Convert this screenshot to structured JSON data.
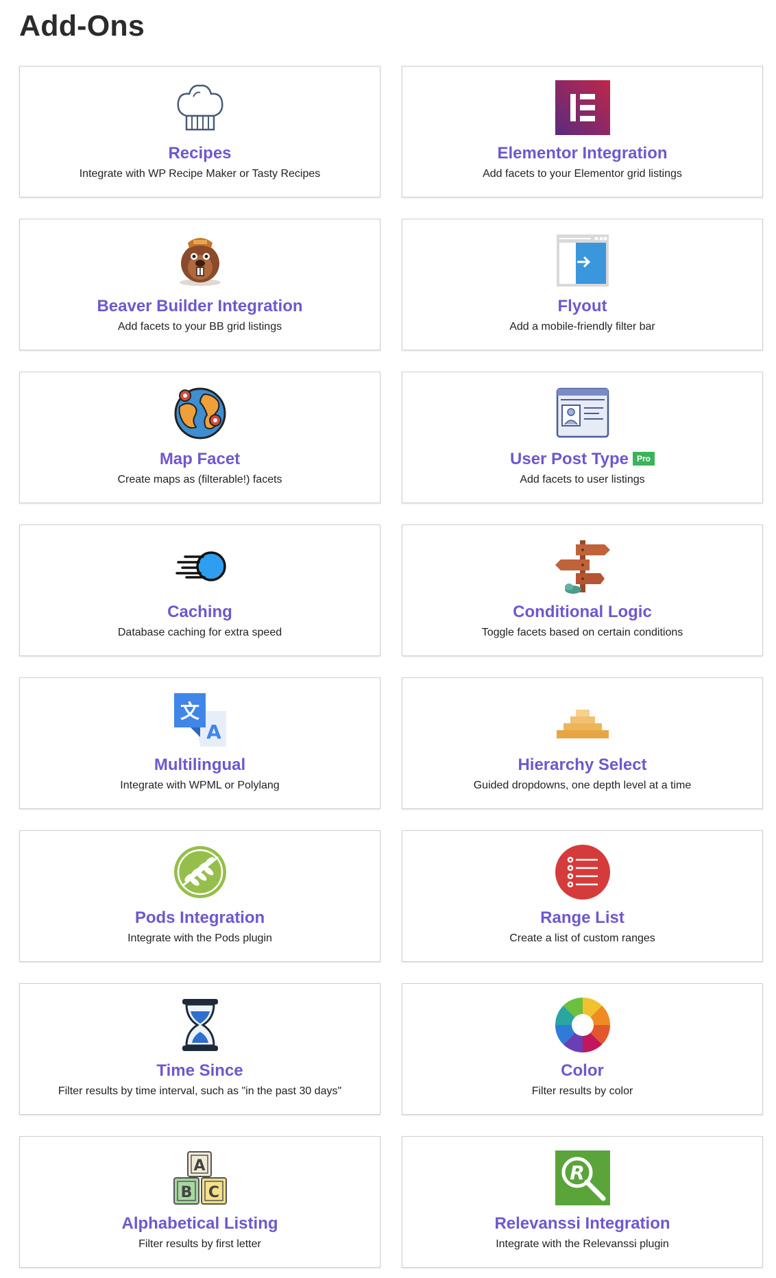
{
  "page": {
    "title": "Add-Ons"
  },
  "addons": [
    {
      "title": "Recipes",
      "desc": "Integrate with WP Recipe Maker or Tasty Recipes",
      "icon": "chef-hat-icon"
    },
    {
      "title": "Elementor Integration",
      "desc": "Add facets to your Elementor grid listings",
      "icon": "elementor-icon"
    },
    {
      "title": "Beaver Builder Integration",
      "desc": "Add facets to your BB grid listings",
      "icon": "beaver-icon"
    },
    {
      "title": "Flyout",
      "desc": "Add a mobile-friendly filter bar",
      "icon": "flyout-window-icon"
    },
    {
      "title": "Map Facet",
      "desc": "Create maps as (filterable!) facets",
      "icon": "globe-pins-icon"
    },
    {
      "title": "User Post Type",
      "desc": "Add facets to user listings",
      "icon": "user-card-icon",
      "badge": "Pro"
    },
    {
      "title": "Caching",
      "desc": "Database caching for extra speed",
      "icon": "speed-ball-icon"
    },
    {
      "title": "Conditional Logic",
      "desc": "Toggle facets based on certain conditions",
      "icon": "signpost-icon"
    },
    {
      "title": "Multilingual",
      "desc": "Integrate with WPML or Polylang",
      "icon": "translate-icon"
    },
    {
      "title": "Hierarchy Select",
      "desc": "Guided dropdowns, one depth level at a time",
      "icon": "pyramid-icon"
    },
    {
      "title": "Pods Integration",
      "desc": "Integrate with the Pods plugin",
      "icon": "pods-leaf-icon"
    },
    {
      "title": "Range List",
      "desc": "Create a list of custom ranges",
      "icon": "list-circle-icon"
    },
    {
      "title": "Time Since",
      "desc": "Filter results by time interval, such as \"in the past 30 days\"",
      "icon": "hourglass-icon"
    },
    {
      "title": "Color",
      "desc": "Filter results by color",
      "icon": "color-wheel-icon"
    },
    {
      "title": "Alphabetical Listing",
      "desc": "Filter results by first letter",
      "icon": "abc-blocks-icon"
    },
    {
      "title": "Relevanssi Integration",
      "desc": "Integrate with the Relevanssi plugin",
      "icon": "relevanssi-icon"
    }
  ],
  "icon_text": {
    "translate_glyph": "文",
    "translate_letter": "A",
    "blocks": [
      "A",
      "B",
      "C"
    ],
    "relevanssi_letter": "R"
  }
}
